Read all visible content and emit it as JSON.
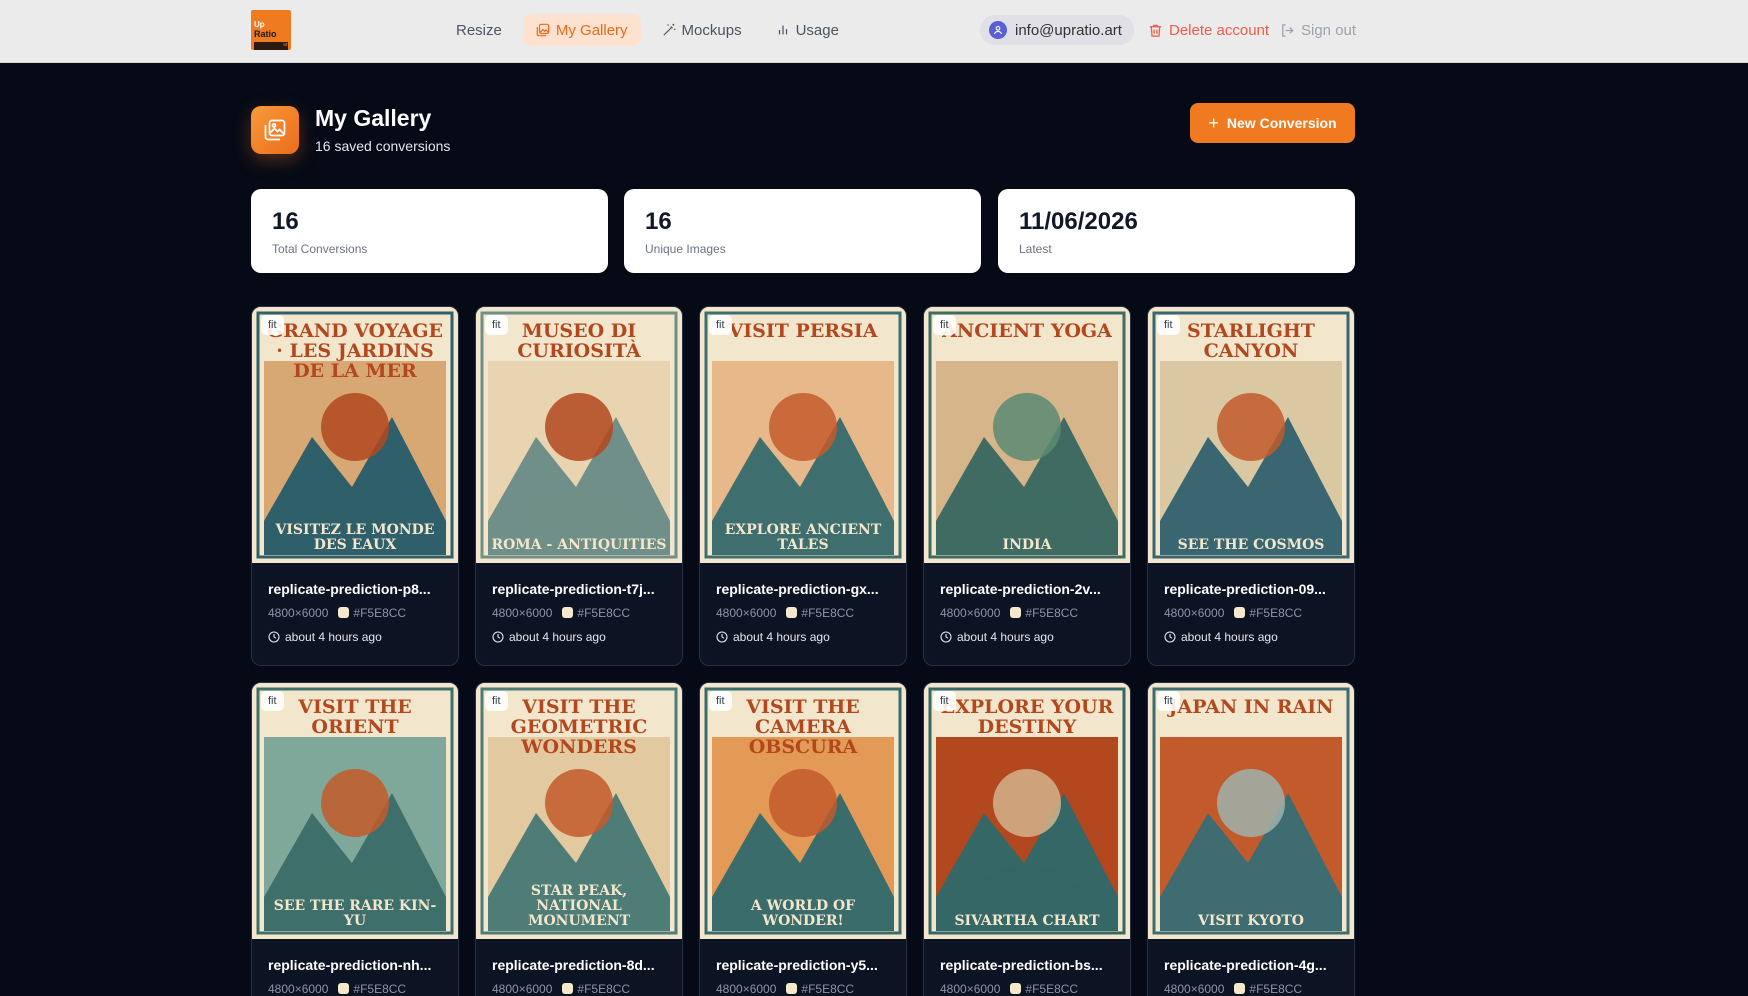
{
  "nav": {
    "logo": {
      "line1": "Up",
      "line2": "Ratio",
      "line3": "art"
    },
    "items": [
      {
        "label": "Resize",
        "icon": "none",
        "active": false
      },
      {
        "label": "My Gallery",
        "icon": "gallery-icon",
        "active": true
      },
      {
        "label": "Mockups",
        "icon": "wand-icon",
        "active": false
      },
      {
        "label": "Usage",
        "icon": "bar-chart-icon",
        "active": false
      }
    ],
    "user_email": "info@upratio.art",
    "delete_label": "Delete account",
    "signout_label": "Sign out"
  },
  "header": {
    "title": "My Gallery",
    "subtitle": "16 saved conversions",
    "new_button": "New Conversion"
  },
  "stats": [
    {
      "value": "16",
      "label": "Total Conversions"
    },
    {
      "value": "16",
      "label": "Unique Images"
    },
    {
      "value": "11/06/2026",
      "label": "Latest"
    }
  ],
  "colors": {
    "accent": "#f07a1f",
    "swatch": "#F5E8CC"
  },
  "cards": [
    {
      "mode": "fit",
      "name": "replicate-prediction-p8...",
      "dims": "4800×6000",
      "color": "#F5E8CC",
      "time": "about 4 hours ago",
      "poster_top": "GRAND VOYAGE · LES JARDINS DE LA MER",
      "poster_bottom": "VISITEZ LE MONDE DES EAUX"
    },
    {
      "mode": "fit",
      "name": "replicate-prediction-t7j...",
      "dims": "4800×6000",
      "color": "#F5E8CC",
      "time": "about 4 hours ago",
      "poster_top": "MUSEO DI CURIOSITÀ",
      "poster_bottom": "ROMA - ANTIQUITIES"
    },
    {
      "mode": "fit",
      "name": "replicate-prediction-gx...",
      "dims": "4800×6000",
      "color": "#F5E8CC",
      "time": "about 4 hours ago",
      "poster_top": "VISIT PERSIA",
      "poster_bottom": "EXPLORE ANCIENT TALES"
    },
    {
      "mode": "fit",
      "name": "replicate-prediction-2v...",
      "dims": "4800×6000",
      "color": "#F5E8CC",
      "time": "about 4 hours ago",
      "poster_top": "ANCIENT YOGA",
      "poster_bottom": "INDIA"
    },
    {
      "mode": "fit",
      "name": "replicate-prediction-09...",
      "dims": "4800×6000",
      "color": "#F5E8CC",
      "time": "about 4 hours ago",
      "poster_top": "STARLIGHT CANYON",
      "poster_bottom": "SEE THE COSMOS"
    },
    {
      "mode": "fit",
      "name": "replicate-prediction-nh...",
      "dims": "4800×6000",
      "color": "#F5E8CC",
      "time": "",
      "poster_top": "VISIT THE ORIENT",
      "poster_bottom": "SEE THE RARE KIN-YU"
    },
    {
      "mode": "fit",
      "name": "replicate-prediction-8d...",
      "dims": "4800×6000",
      "color": "#F5E8CC",
      "time": "",
      "poster_top": "VISIT THE GEOMETRIC WONDERS",
      "poster_bottom": "STAR PEAK, NATIONAL MONUMENT"
    },
    {
      "mode": "fit",
      "name": "replicate-prediction-y5...",
      "dims": "4800×6000",
      "color": "#F5E8CC",
      "time": "",
      "poster_top": "VISIT THE CAMERA OBSCURA",
      "poster_bottom": "A WORLD OF WONDER!"
    },
    {
      "mode": "fit",
      "name": "replicate-prediction-bs...",
      "dims": "4800×6000",
      "color": "#F5E8CC",
      "time": "",
      "poster_top": "EXPLORE YOUR DESTINY",
      "poster_bottom": "SIVARTHA CHART"
    },
    {
      "mode": "fit",
      "name": "replicate-prediction-4g...",
      "dims": "4800×6000",
      "color": "#F5E8CC",
      "time": "",
      "poster_top": "JAPAN IN RAIN",
      "poster_bottom": "VISIT KYOTO"
    }
  ]
}
